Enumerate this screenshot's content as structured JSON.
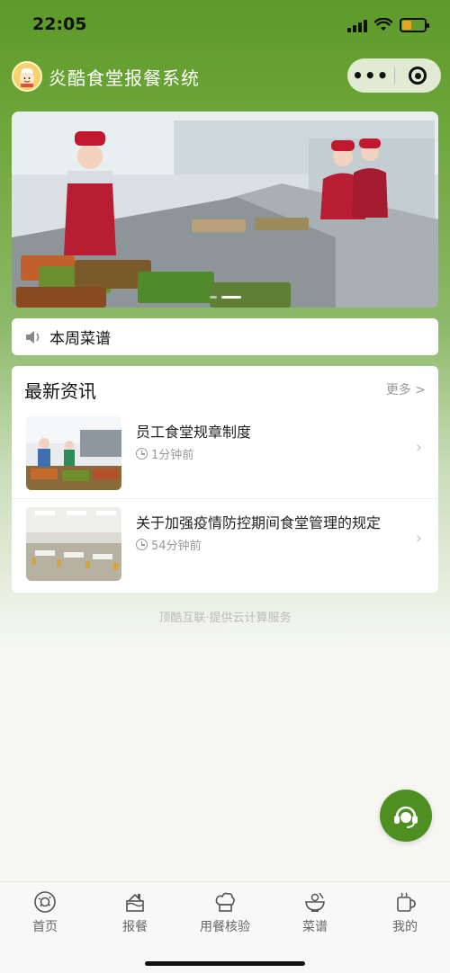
{
  "status_bar": {
    "time": "22:05",
    "battery_color": "#e8a423"
  },
  "header": {
    "title": "炎酷食堂报餐系统",
    "logo_icon": "chef-logo-icon"
  },
  "banner": {
    "slide_count": 2,
    "active_slide": 2
  },
  "notice": {
    "text": "本周菜谱",
    "icon": "speaker-icon"
  },
  "news": {
    "title": "最新资讯",
    "more_label": "更多 >",
    "items": [
      {
        "title": "员工食堂规章制度",
        "time": "1分钟前"
      },
      {
        "title": "关于加强疫情防控期间食堂管理的规定",
        "time": "54分钟前"
      }
    ]
  },
  "footer": {
    "text": "顶酷互联·提供云计算服务"
  },
  "tabbar": {
    "items": [
      {
        "label": "首页",
        "icon": "donut-icon"
      },
      {
        "label": "报餐",
        "icon": "cake-icon"
      },
      {
        "label": "用餐核验",
        "icon": "chef-hat-icon"
      },
      {
        "label": "菜谱",
        "icon": "bowl-icon"
      },
      {
        "label": "我的",
        "icon": "cup-icon"
      }
    ]
  },
  "colors": {
    "brand_green": "#5d9a2a",
    "fab_green": "#4e8f22"
  }
}
